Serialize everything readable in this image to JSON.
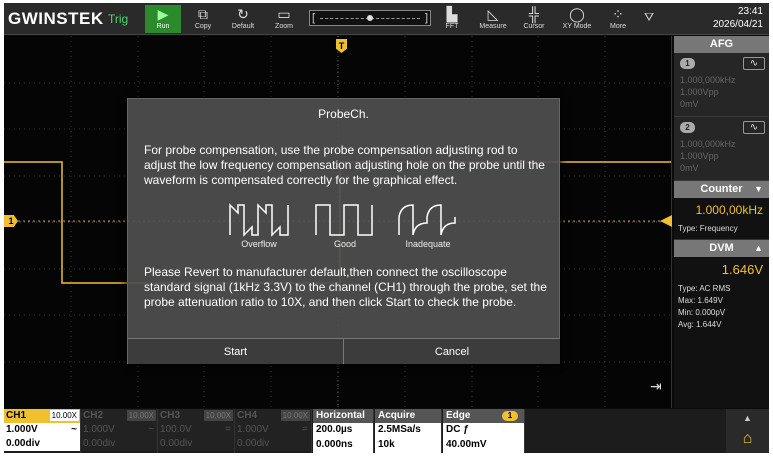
{
  "brand": "GWINSTEK",
  "trig_status": "Trig",
  "toolbar": {
    "run": "Run",
    "copy": "Copy",
    "default": "Default",
    "zoom": "Zoom",
    "fft": "FFT",
    "measure": "Measure",
    "cursor": "Cursor",
    "xy_mode": "XY Mode",
    "more": "More"
  },
  "clock": {
    "time": "23:41",
    "date": "2026/04/21"
  },
  "trigger_marker": "T",
  "channel_marker": "1",
  "dialog": {
    "title": "ProbeCh.",
    "paragraph1": "For probe compensation, use the probe compensation adjusting rod to adjust the low frequency compensation adjusting hole on the probe until the waveform is compensated correctly for the graphical effect.",
    "waves": [
      {
        "label": "Overflow"
      },
      {
        "label": "Good"
      },
      {
        "label": "Inadequate"
      }
    ],
    "paragraph2": "Please Revert to manufacturer default,then connect the oscilloscope standard signal (1kHz 3.3V) to the channel (CH1) through the probe, set the probe attenuation ratio to 10X, and then click Start to check the probe.",
    "start": "Start",
    "cancel": "Cancel"
  },
  "right_panel": {
    "afg_title": "AFG",
    "afg": [
      {
        "num": "1",
        "freq": "1.000,000kHz",
        "amp": "1.000Vpp",
        "offset": "0mV"
      },
      {
        "num": "2",
        "freq": "1.000,000kHz",
        "amp": "1.000Vpp",
        "offset": "0mV"
      }
    ],
    "counter_title": "Counter",
    "counter_value": "1.000,00kHz",
    "counter_type": "Type: Frequency",
    "dvm_title": "DVM",
    "dvm_value": "1.646V",
    "dvm_type": "Type: AC RMS",
    "dvm_max": "Max: 1.649V",
    "dvm_min": "Min: 0.000pV",
    "dvm_avg": "Avg: 1.644V"
  },
  "bottom": {
    "channels": [
      {
        "name": "CH1",
        "att": "10.00X",
        "volt": "1.000V",
        "coupling": "~",
        "offset": "0.00div",
        "active": true
      },
      {
        "name": "CH2",
        "att": "10.00X",
        "volt": "1.000V",
        "coupling": "~",
        "offset": "0.00div",
        "active": false
      },
      {
        "name": "CH3",
        "att": "10.00X",
        "volt": "100.0V",
        "coupling": "=",
        "offset": "0.00div",
        "active": false
      },
      {
        "name": "CH4",
        "att": "10.00X",
        "volt": "1.000V",
        "coupling": "=",
        "offset": "0.00div",
        "active": false
      }
    ],
    "horizontal": {
      "title": "Horizontal",
      "timebase": "200.0µs",
      "delay": "0.000ns"
    },
    "acquire": {
      "title": "Acquire",
      "rate": "2.5MSa/s",
      "depth": "10k"
    },
    "edge": {
      "title": "Edge",
      "badge": "1",
      "coupling": "DC ƒ",
      "level": "40.00mV"
    }
  }
}
